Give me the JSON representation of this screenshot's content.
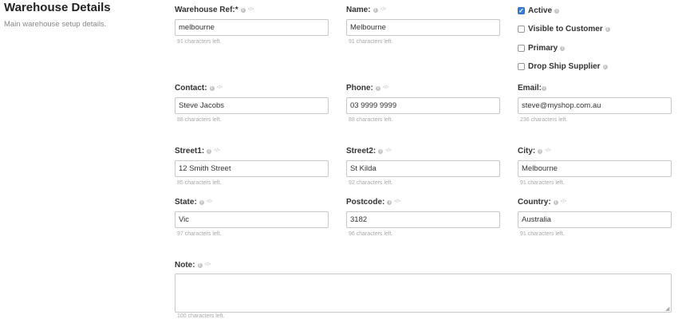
{
  "section": {
    "title": "Warehouse Details",
    "subtitle": "Main warehouse setup details."
  },
  "fields": {
    "warehouse_ref": {
      "label": "Warehouse Ref:*",
      "value": "melbourne",
      "hint": "91 characters left."
    },
    "name": {
      "label": "Name:",
      "value": "Melbourne",
      "hint": "91 characters left."
    },
    "contact": {
      "label": "Contact:",
      "value": "Steve Jacobs",
      "hint": "88 characters left."
    },
    "phone": {
      "label": "Phone:",
      "value": "03 9999 9999",
      "hint": "88 characters left."
    },
    "email": {
      "label": "Email:",
      "value": "steve@myshop.com.au",
      "hint": "236 characters left."
    },
    "street1": {
      "label": "Street1:",
      "value": "12 Smith Street",
      "hint": "85 characters left."
    },
    "street2": {
      "label": "Street2:",
      "value": "St Kilda",
      "hint": "92 characters left."
    },
    "city": {
      "label": "City:",
      "value": "Melbourne",
      "hint": "91 characters left."
    },
    "state": {
      "label": "State:",
      "value": "Vic",
      "hint": "97 characters left."
    },
    "postcode": {
      "label": "Postcode:",
      "value": "3182",
      "hint": "96 characters left."
    },
    "country": {
      "label": "Country:",
      "value": "Australia",
      "hint": "91 characters left."
    },
    "note": {
      "label": "Note:",
      "value": "",
      "hint": "100 characters left."
    }
  },
  "checkboxes": {
    "active": {
      "label": "Active",
      "checked": true
    },
    "visible_to_customer": {
      "label": "Visible to Customer",
      "checked": false
    },
    "primary": {
      "label": "Primary",
      "checked": false
    },
    "drop_ship_supplier": {
      "label": "Drop Ship Supplier",
      "checked": false
    }
  },
  "icons": {
    "info": "info-circle-icon",
    "code": "code-brackets-icon",
    "check": "checkmark-icon"
  },
  "colors": {
    "checkbox_checked": "#3b7ddd",
    "input_border": "#c8c8c8",
    "hint_text": "#aaaaaa"
  }
}
